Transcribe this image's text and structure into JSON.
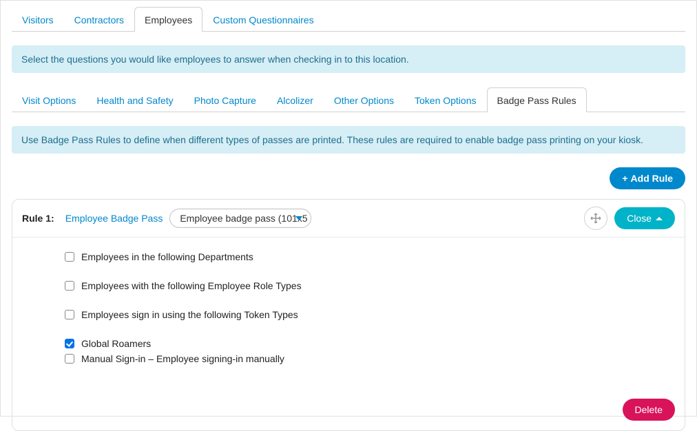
{
  "topTabs": [
    {
      "label": "Visitors"
    },
    {
      "label": "Contractors"
    },
    {
      "label": "Employees"
    },
    {
      "label": "Custom Questionnaires"
    }
  ],
  "activeTopTab": 2,
  "infoBar1": "Select the questions you would like employees to answer when checking in to this location.",
  "subTabs": [
    {
      "label": "Visit Options"
    },
    {
      "label": "Health and Safety"
    },
    {
      "label": "Photo Capture"
    },
    {
      "label": "Alcolizer"
    },
    {
      "label": "Other Options"
    },
    {
      "label": "Token Options"
    },
    {
      "label": "Badge Pass Rules"
    }
  ],
  "activeSubTab": 6,
  "infoBar2": "Use Badge Pass Rules to define when different types of passes are printed. These rules are required to enable badge pass printing on your kiosk.",
  "addRuleLabel": "Add Rule",
  "rule": {
    "title": "Rule 1:",
    "name": "Employee Badge Pass",
    "selectDisplay": "Employee badge pass (101x5",
    "closeLabel": "Close",
    "checks": [
      {
        "label": "Employees in the following Departments",
        "checked": false
      },
      {
        "label": "Employees with the following Employee Role Types",
        "checked": false
      },
      {
        "label": "Employees sign in using the following Token Types",
        "checked": false
      },
      {
        "label": "Global Roamers",
        "checked": true
      },
      {
        "label": "Manual Sign-in – Employee signing-in manually",
        "checked": false
      }
    ],
    "deleteLabel": "Delete"
  }
}
